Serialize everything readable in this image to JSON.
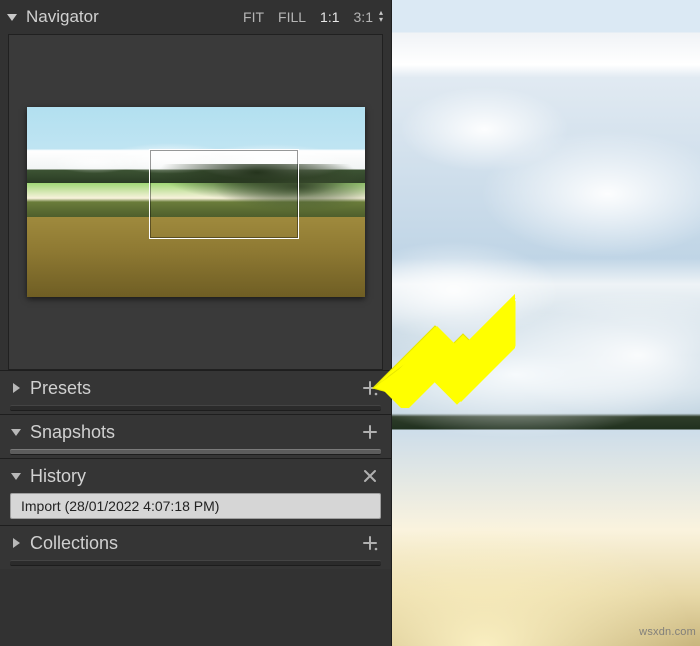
{
  "navigator": {
    "title": "Navigator",
    "zoom": {
      "fit": "FIT",
      "fill": "FILL",
      "one_one": "1:1",
      "ratio": "3:1"
    }
  },
  "panels": {
    "presets": {
      "title": "Presets",
      "expanded": false,
      "action_icon": "plus-dot"
    },
    "snapshots": {
      "title": "Snapshots",
      "expanded": true,
      "action_icon": "plus"
    },
    "history": {
      "title": "History",
      "expanded": true,
      "action_icon": "close",
      "entry": "Import (28/01/2022 4:07:18 PM)"
    },
    "collections": {
      "title": "Collections",
      "expanded": false,
      "action_icon": "plus-dot"
    }
  },
  "watermark": "wsxdn.com"
}
